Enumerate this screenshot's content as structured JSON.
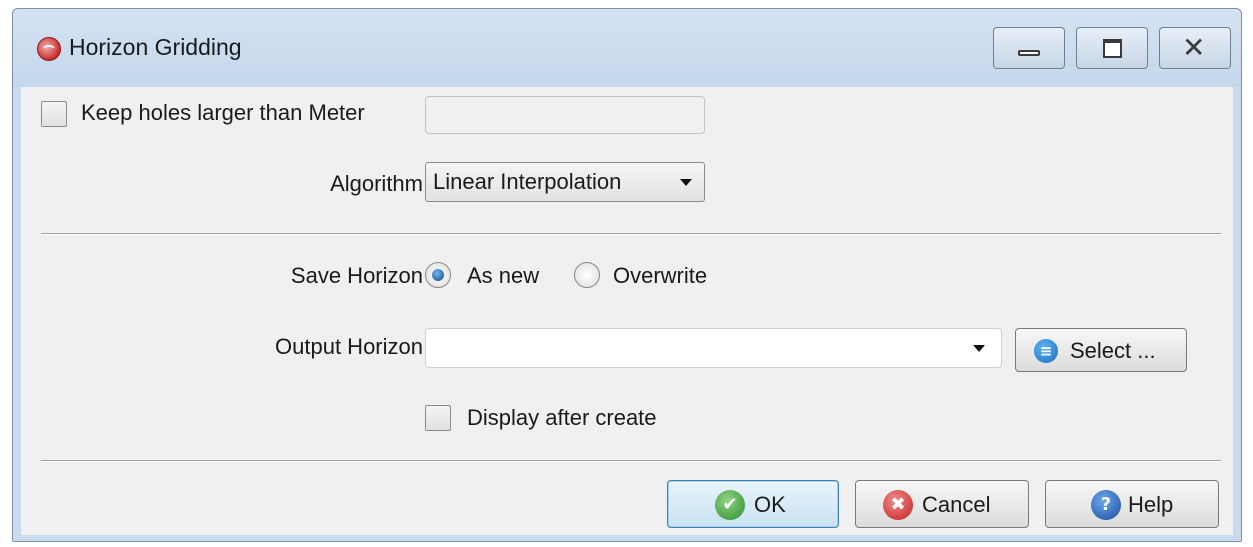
{
  "window": {
    "title": "Horizon Gridding",
    "controls": {
      "minimize_icon": "minimize-icon",
      "maximize_icon": "maximize-icon",
      "close_icon": "close-icon"
    }
  },
  "form": {
    "keep_holes": {
      "label": "Keep holes larger than Meter",
      "checked": false,
      "value": ""
    },
    "algorithm": {
      "label": "Algorithm",
      "selected": "Linear Interpolation"
    },
    "save_horizon": {
      "label": "Save Horizon",
      "options": [
        {
          "label": "As new",
          "selected": true
        },
        {
          "label": "Overwrite",
          "selected": false
        }
      ]
    },
    "output_horizon": {
      "label": "Output Horizon",
      "value": "",
      "select_label": "Select ..."
    },
    "display_after_create": {
      "label": "Display after create",
      "checked": false
    }
  },
  "buttons": {
    "ok": "OK",
    "cancel": "Cancel",
    "help": "Help"
  },
  "icons": {
    "ok_glyph": "✔",
    "cancel_glyph": "✖",
    "help_glyph": "?",
    "close_glyph": "✕"
  }
}
